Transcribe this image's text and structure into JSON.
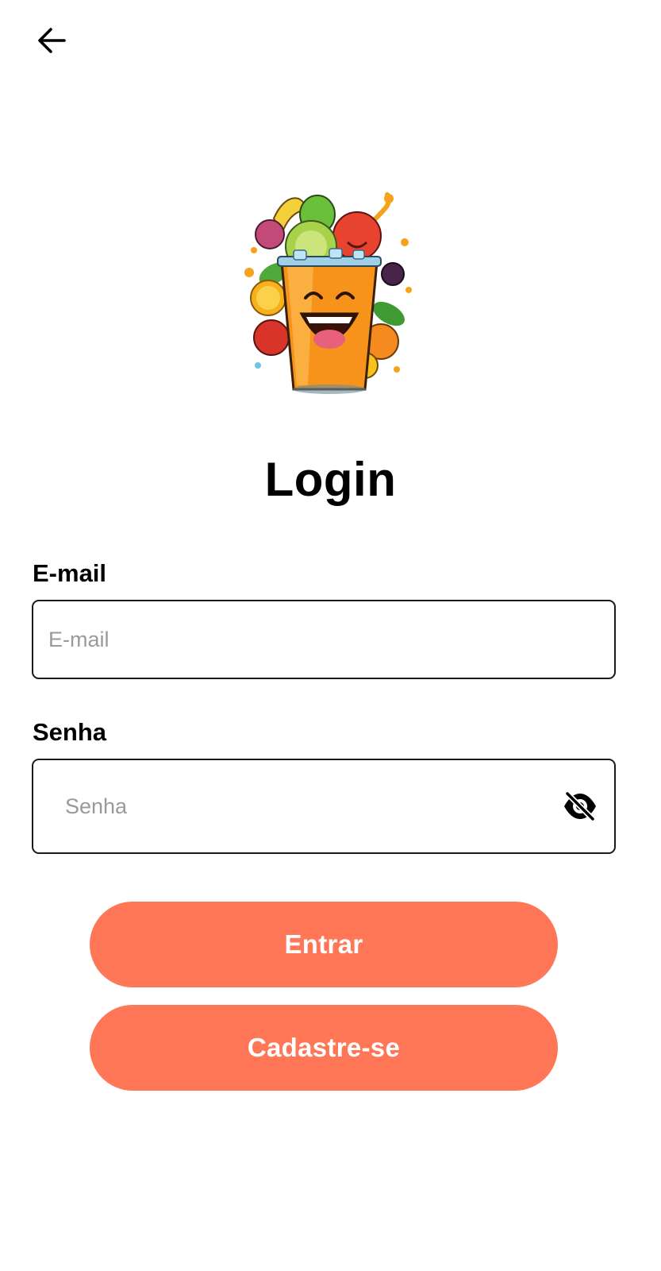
{
  "header": {
    "back_icon": "arrow-left-icon"
  },
  "logo": {
    "description_icon": "fruit-juice-cup-mascot"
  },
  "title": "Login",
  "form": {
    "email": {
      "label": "E-mail",
      "placeholder": "E-mail",
      "value": ""
    },
    "password": {
      "label": "Senha",
      "placeholder": "Senha",
      "value": "",
      "toggle_icon": "eye-off-icon"
    }
  },
  "buttons": {
    "login_label": "Entrar",
    "signup_label": "Cadastre-se"
  },
  "colors": {
    "accent": "#ff7757",
    "text": "#000000",
    "placeholder": "#9a9a9a",
    "border": "#1a1a1a"
  }
}
